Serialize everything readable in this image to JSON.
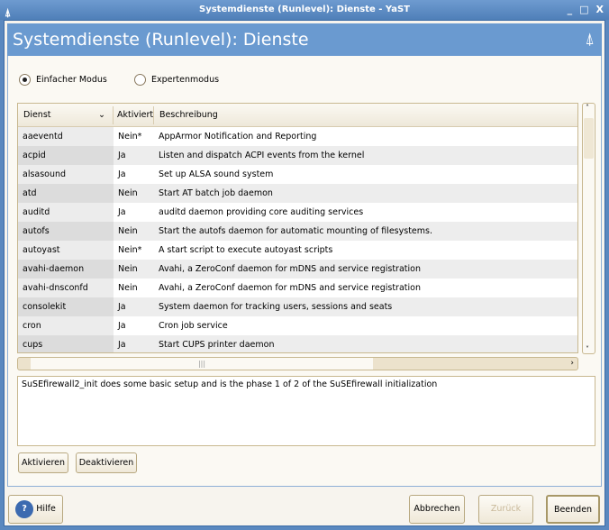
{
  "window": {
    "title": "Systemdienste (Runlevel): Dienste - YaST",
    "minimize": "_",
    "maximize": "□",
    "close": "X"
  },
  "header": {
    "title": "Systemdienste (Runlevel): Dienste"
  },
  "modes": {
    "simple": "Einfacher Modus",
    "expert": "Expertenmodus",
    "selected": "simple"
  },
  "table": {
    "columns": [
      "Dienst",
      "Aktiviert",
      "Beschreibung"
    ],
    "rows": [
      [
        "aaeventd",
        "Nein*",
        "AppArmor Notification and Reporting"
      ],
      [
        "acpid",
        "Ja",
        "Listen and dispatch ACPI events from the kernel"
      ],
      [
        "alsasound",
        "Ja",
        "Set up ALSA sound system"
      ],
      [
        "atd",
        "Nein",
        "Start AT batch job daemon"
      ],
      [
        "auditd",
        "Ja",
        "auditd daemon providing core auditing services"
      ],
      [
        "autofs",
        "Nein",
        "Start the autofs daemon for automatic mounting of filesystems."
      ],
      [
        "autoyast",
        "Nein*",
        "A start script to execute autoyast scripts"
      ],
      [
        "avahi-daemon",
        "Nein",
        "Avahi, a ZeroConf daemon for mDNS and service registration"
      ],
      [
        "avahi-dnsconfd",
        "Nein",
        "Avahi, a ZeroConf daemon for mDNS and service registration"
      ],
      [
        "consolekit",
        "Ja",
        "System daemon for tracking users, sessions and seats"
      ],
      [
        "cron",
        "Ja",
        "Cron job service"
      ],
      [
        "cups",
        "Ja",
        "Start CUPS printer daemon"
      ]
    ]
  },
  "description": "SuSEfirewall2_init does some basic setup and is the phase 1 of 2 of the SuSEfirewall initialization",
  "buttons": {
    "activate": "Aktivieren",
    "deactivate": "Deaktivieren",
    "help": "Hilfe",
    "cancel": "Abbrechen",
    "back": "Zurück",
    "finish": "Beenden"
  }
}
